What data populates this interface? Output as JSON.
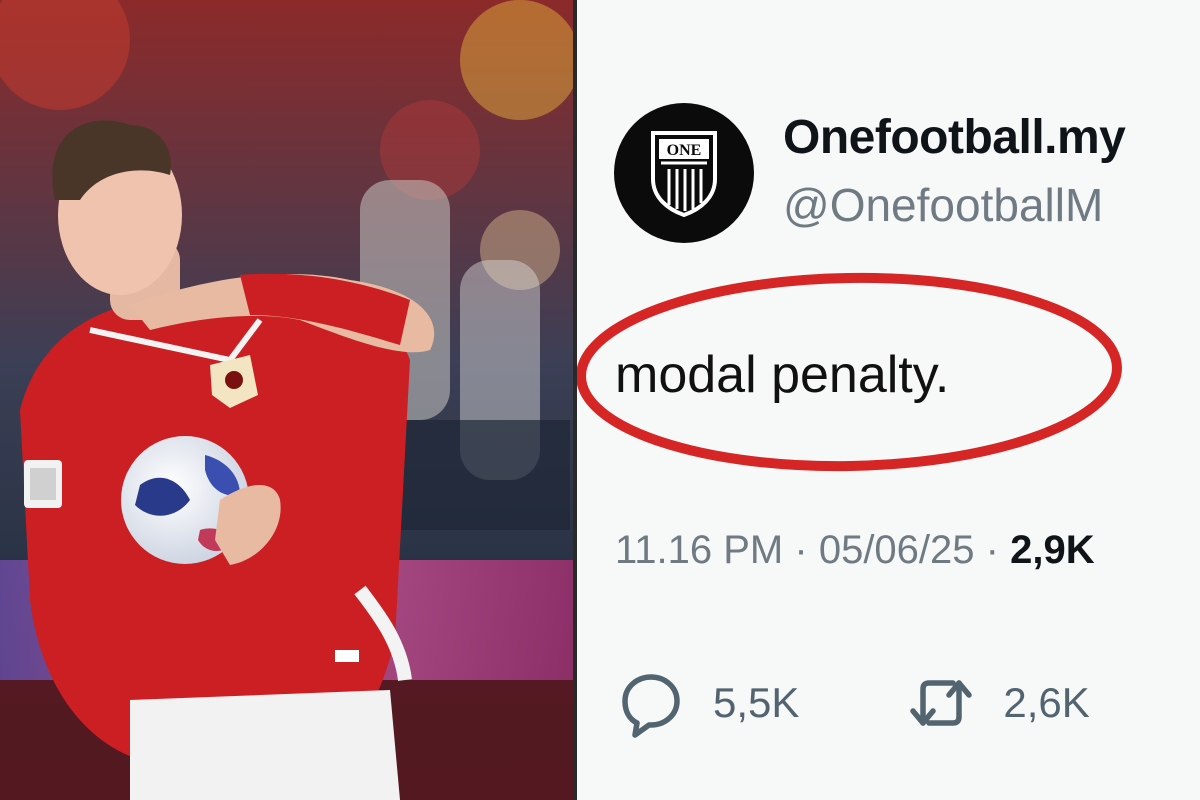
{
  "tweet": {
    "display_name": "Onefootball.my",
    "handle": "@OnefootballM",
    "text": "modal penalty.",
    "time": "11.16 PM",
    "date": "05/06/25",
    "views": "2,9K",
    "sep1": "·",
    "sep2": "·",
    "replies": "5,5K",
    "retweets": "2,6K",
    "avatar_logo_text": "ONE",
    "accent_circle_color": "#d62525"
  },
  "icons": [
    "reply-icon",
    "retweet-icon"
  ]
}
